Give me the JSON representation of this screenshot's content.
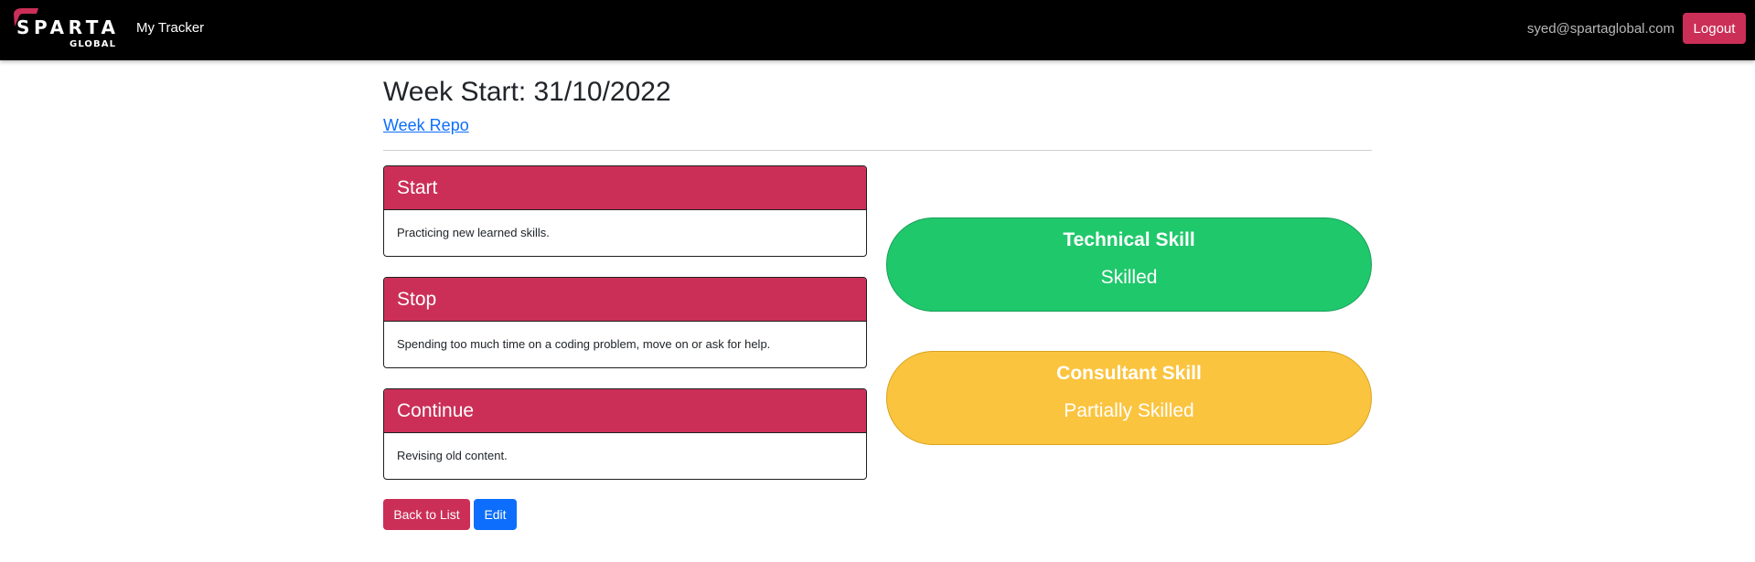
{
  "navbar": {
    "logo": {
      "top_text": "SPARTA",
      "bottom_text": "GLOBAL",
      "accent_color": "#cb2f57"
    },
    "brand_link": "My Tracker",
    "user_email": "syed@spartaglobal.com",
    "logout_label": "Logout"
  },
  "header": {
    "title": "Week Start: 31/10/2022",
    "repo_link": "Week Repo"
  },
  "cards": [
    {
      "title": "Start",
      "body": "Practicing new learned skills."
    },
    {
      "title": "Stop",
      "body": "Spending too much time on a coding problem, move on or ask for help."
    },
    {
      "title": "Continue",
      "body": "Revising old content."
    }
  ],
  "skills": [
    {
      "title": "Technical Skill",
      "level": "Skilled",
      "color": "#20c86c"
    },
    {
      "title": "Consultant Skill",
      "level": "Partially Skilled",
      "color": "#fbc43f"
    }
  ],
  "actions": {
    "back_label": "Back to List",
    "edit_label": "Edit"
  }
}
